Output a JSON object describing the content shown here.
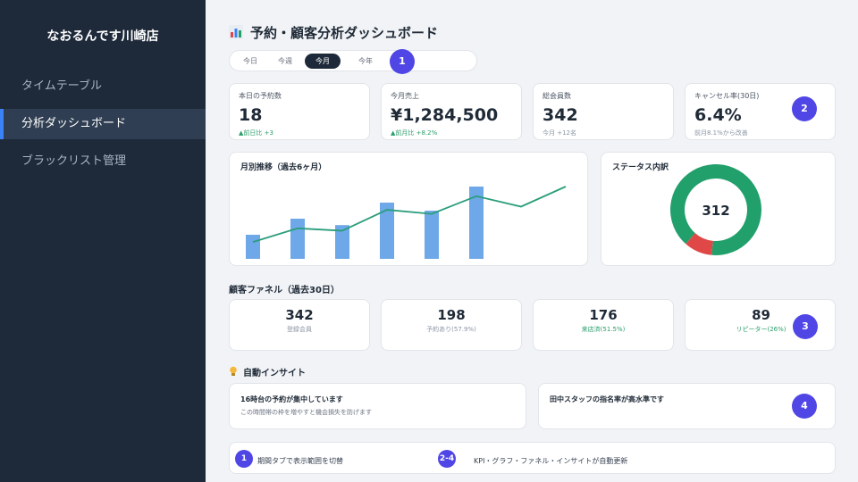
{
  "sidebar": {
    "store_name": "なおるんです川崎店",
    "items": [
      {
        "label": "タイムテーブル"
      },
      {
        "label": "分析ダッシュボード"
      },
      {
        "label": "ブラックリスト管理"
      }
    ]
  },
  "header": {
    "title": "予約・顧客分析ダッシュボード",
    "title_icon": "bar-chart-icon"
  },
  "tabs": [
    {
      "label": "今日"
    },
    {
      "label": "今週"
    },
    {
      "label": "今月"
    },
    {
      "label": "今年"
    }
  ],
  "badges": [
    "1",
    "2",
    "3",
    "4"
  ],
  "kpis": [
    {
      "label": "本日の予約数",
      "value": "18",
      "sub": "▲前日比 +3"
    },
    {
      "label": "今月売上",
      "value": "¥1,284,500",
      "sub": "▲前月比 +8.2%"
    },
    {
      "label": "総会員数",
      "value": "342",
      "sub": "今月 +12名"
    },
    {
      "label": "キャンセル率(30日)",
      "value": "6.4%",
      "sub": "前月8.1%から改善"
    }
  ],
  "monthly": {
    "title": "月別推移（過去6ヶ月）"
  },
  "status": {
    "title": "ステータス内訳",
    "center_value": "312"
  },
  "chart_data": [
    {
      "type": "bar",
      "title": "月別推移（過去6ヶ月）",
      "bars": [
        30,
        50,
        42,
        70,
        60,
        90
      ],
      "line": [
        21,
        38,
        35,
        61,
        56,
        78,
        65,
        90
      ],
      "ylim": [
        0,
        100
      ],
      "colors": {
        "bar": "#6ea8e8",
        "line": "#2a9d7a"
      }
    },
    {
      "type": "pie",
      "title": "ステータス内訳",
      "center_label": "312",
      "slices": [
        {
          "value": 90,
          "color": "#22a06b"
        },
        {
          "value": 10,
          "color": "#e04848"
        }
      ]
    }
  ],
  "funnel": {
    "title": "顧客ファネル（過去30日）",
    "stages": [
      {
        "value": "342",
        "label": "登録会員"
      },
      {
        "value": "198",
        "label": "予約あり(57.9%)"
      },
      {
        "value": "176",
        "label": "来店済(51.5%)"
      },
      {
        "value": "89",
        "label": "リピーター(26%)"
      }
    ]
  },
  "insights": {
    "title": "自動インサイト",
    "icon": "lightbulb-icon",
    "items": [
      {
        "title": "16時台の予約が集中しています",
        "desc": "この時間帯の枠を増やすと機会損失を防げます"
      },
      {
        "title": "田中スタッフの指名率が高水準です",
        "desc": ""
      }
    ]
  },
  "legend": {
    "items": [
      {
        "badge": "1",
        "text": "期間タブで表示範囲を切替"
      },
      {
        "badge": "2-4",
        "text": "KPI・グラフ・ファネル・インサイトが自動更新"
      }
    ]
  },
  "colors": {
    "sidebar_bg": "#1e2a3a",
    "accent": "#4f46e5",
    "active_indicator": "#3b82f6",
    "positive": "#2a9d6a"
  }
}
